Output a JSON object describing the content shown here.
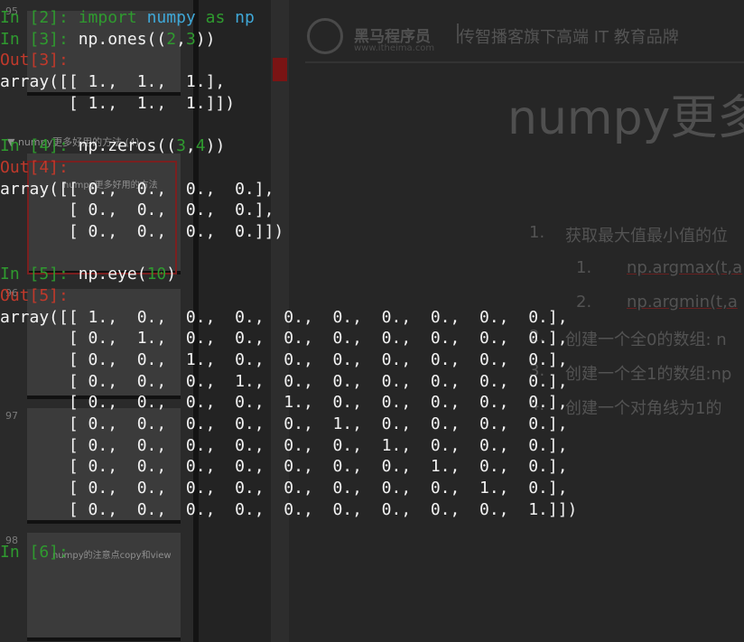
{
  "slides_panel": {
    "section_label": "▼ numpy更多好用的方法 (4)",
    "slide_numbers": [
      "95",
      "96",
      "97",
      "98"
    ],
    "slide_captions": [
      "numpy更多好用的方法",
      "numpy的注意点copy和view"
    ]
  },
  "slide": {
    "brand": "黑马程序员",
    "brand_url": "www.itheima.com",
    "tagline": "传智播客旗下高端 IT 教育品牌",
    "title": "numpy更多",
    "bullets": [
      {
        "num": "1.",
        "text": "获取最大值最小值的位"
      },
      {
        "num": "1.",
        "text": "np.argmax(t,a"
      },
      {
        "num": "2.",
        "text": "np.argmin(t,a"
      },
      {
        "num": "2.",
        "text": "创建一个全0的数组: n"
      },
      {
        "num": "3.",
        "text": "创建一个全1的数组:np"
      },
      {
        "num": "4.",
        "text": "创建一个对角线为1的"
      }
    ]
  },
  "terminal": {
    "cells": [
      {
        "prompt": "In [2]:",
        "kind": "in",
        "code_parts": [
          [
            "import",
            "kw"
          ],
          [
            " ",
            "plain"
          ],
          [
            "numpy",
            "mod"
          ],
          [
            " ",
            "plain"
          ],
          [
            "as",
            "kw"
          ],
          [
            " ",
            "plain"
          ],
          [
            "np",
            "mod"
          ]
        ]
      },
      {
        "prompt": "In [3]:",
        "kind": "in",
        "code_parts": [
          [
            "np.ones((",
            "plain"
          ],
          [
            "2",
            "num"
          ],
          [
            ",",
            "plain"
          ],
          [
            "3",
            "num"
          ],
          [
            "))",
            "plain"
          ]
        ]
      },
      {
        "prompt": "Out[3]:",
        "kind": "out"
      },
      {
        "text": "array([[ 1.,  1.,  1.],",
        "kind": "text"
      },
      {
        "text": "       [ 1.,  1.,  1.]])",
        "kind": "text"
      },
      {
        "text": "",
        "kind": "blank"
      },
      {
        "prompt": "In [4]:",
        "kind": "in",
        "code_parts": [
          [
            "np.zeros((",
            "plain"
          ],
          [
            "3",
            "num"
          ],
          [
            ",",
            "plain"
          ],
          [
            "4",
            "num"
          ],
          [
            "))",
            "plain"
          ]
        ]
      },
      {
        "prompt": "Out[4]:",
        "kind": "out"
      },
      {
        "text": "array([[ 0.,  0.,  0.,  0.],",
        "kind": "text"
      },
      {
        "text": "       [ 0.,  0.,  0.,  0.],",
        "kind": "text"
      },
      {
        "text": "       [ 0.,  0.,  0.,  0.]])",
        "kind": "text"
      },
      {
        "text": "",
        "kind": "blank"
      },
      {
        "prompt": "In [5]:",
        "kind": "in",
        "code_parts": [
          [
            "np.eye(",
            "plain"
          ],
          [
            "10",
            "num"
          ],
          [
            ")",
            "plain"
          ]
        ]
      },
      {
        "prompt": "Out[5]:",
        "kind": "out"
      },
      {
        "text": "array([[ 1.,  0.,  0.,  0.,  0.,  0.,  0.,  0.,  0.,  0.],",
        "kind": "text"
      },
      {
        "text": "       [ 0.,  1.,  0.,  0.,  0.,  0.,  0.,  0.,  0.,  0.],",
        "kind": "text"
      },
      {
        "text": "       [ 0.,  0.,  1.,  0.,  0.,  0.,  0.,  0.,  0.,  0.],",
        "kind": "text"
      },
      {
        "text": "       [ 0.,  0.,  0.,  1.,  0.,  0.,  0.,  0.,  0.,  0.],",
        "kind": "text"
      },
      {
        "text": "       [ 0.,  0.,  0.,  0.,  1.,  0.,  0.,  0.,  0.,  0.],",
        "kind": "text"
      },
      {
        "text": "       [ 0.,  0.,  0.,  0.,  0.,  1.,  0.,  0.,  0.,  0.],",
        "kind": "text"
      },
      {
        "text": "       [ 0.,  0.,  0.,  0.,  0.,  0.,  1.,  0.,  0.,  0.],",
        "kind": "text"
      },
      {
        "text": "       [ 0.,  0.,  0.,  0.,  0.,  0.,  0.,  1.,  0.,  0.],",
        "kind": "text"
      },
      {
        "text": "       [ 0.,  0.,  0.,  0.,  0.,  0.,  0.,  0.,  1.,  0.],",
        "kind": "text"
      },
      {
        "text": "       [ 0.,  0.,  0.,  0.,  0.,  0.,  0.,  0.,  0.,  1.]])",
        "kind": "text"
      },
      {
        "text": "",
        "kind": "blank"
      },
      {
        "prompt": "In [6]:",
        "kind": "in",
        "code_parts": []
      }
    ]
  },
  "colors": {
    "prompt_in": "#2f9a2f",
    "prompt_out": "#c0392b",
    "module": "#3fa8d8",
    "text": "#f2f2f2"
  }
}
